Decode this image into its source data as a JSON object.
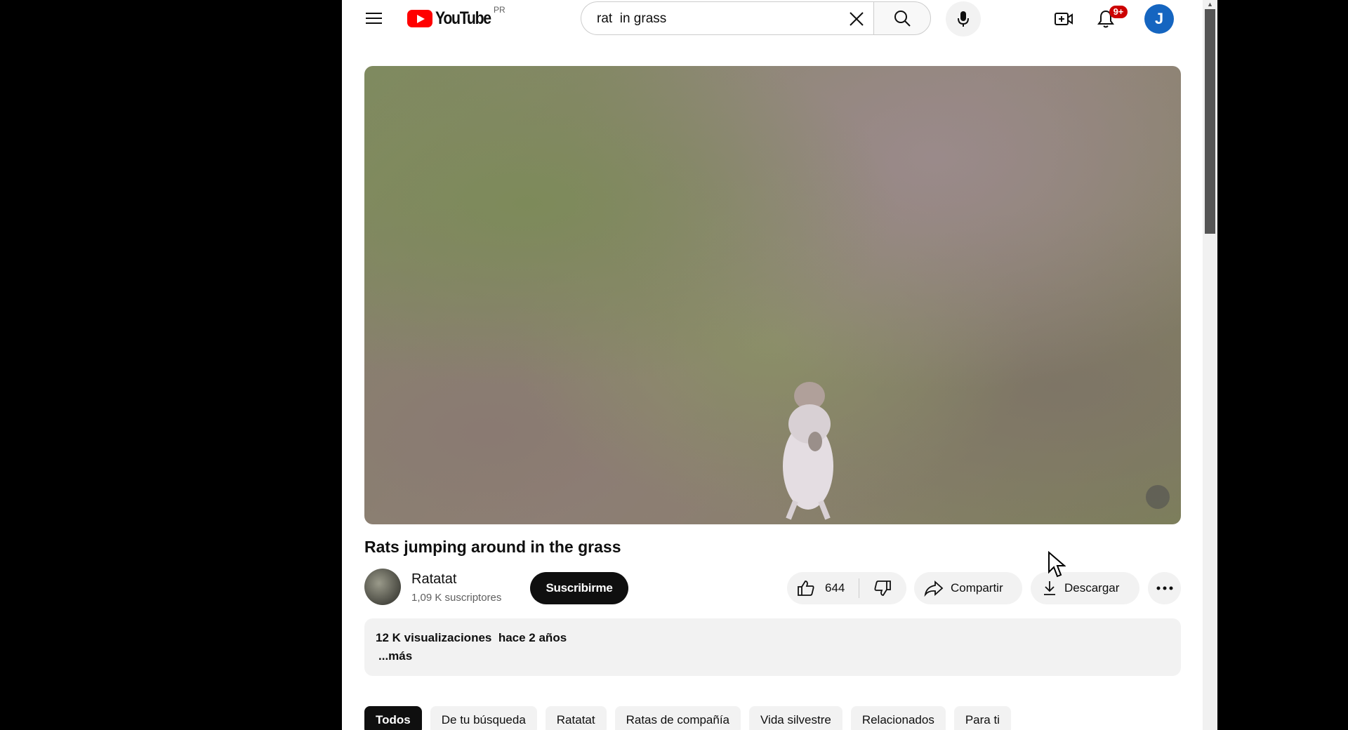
{
  "header": {
    "logo_text": "YouTube",
    "region": "PR",
    "search_value": "rat  in grass",
    "notifications_badge": "9+",
    "avatar_letter": "J"
  },
  "video": {
    "title": "Rats jumping around in the grass"
  },
  "channel": {
    "name": "Ratatat",
    "subscribers": "1,09 K suscriptores",
    "subscribe_label": "Suscribirme"
  },
  "actions": {
    "likes": "644",
    "share_label": "Compartir",
    "download_label": "Descargar"
  },
  "description": {
    "views": "12 K visualizaciones",
    "date": "hace 2 años",
    "more_label": "...más"
  },
  "chips": [
    "Todos",
    "De tu búsqueda",
    "Ratatat",
    "Ratas de compañía",
    "Vida silvestre",
    "Relacionados",
    "Para ti"
  ],
  "colors": {
    "brand_red": "#ff0000",
    "avatar_blue": "#1565c0",
    "badge_red": "#cc0000"
  }
}
